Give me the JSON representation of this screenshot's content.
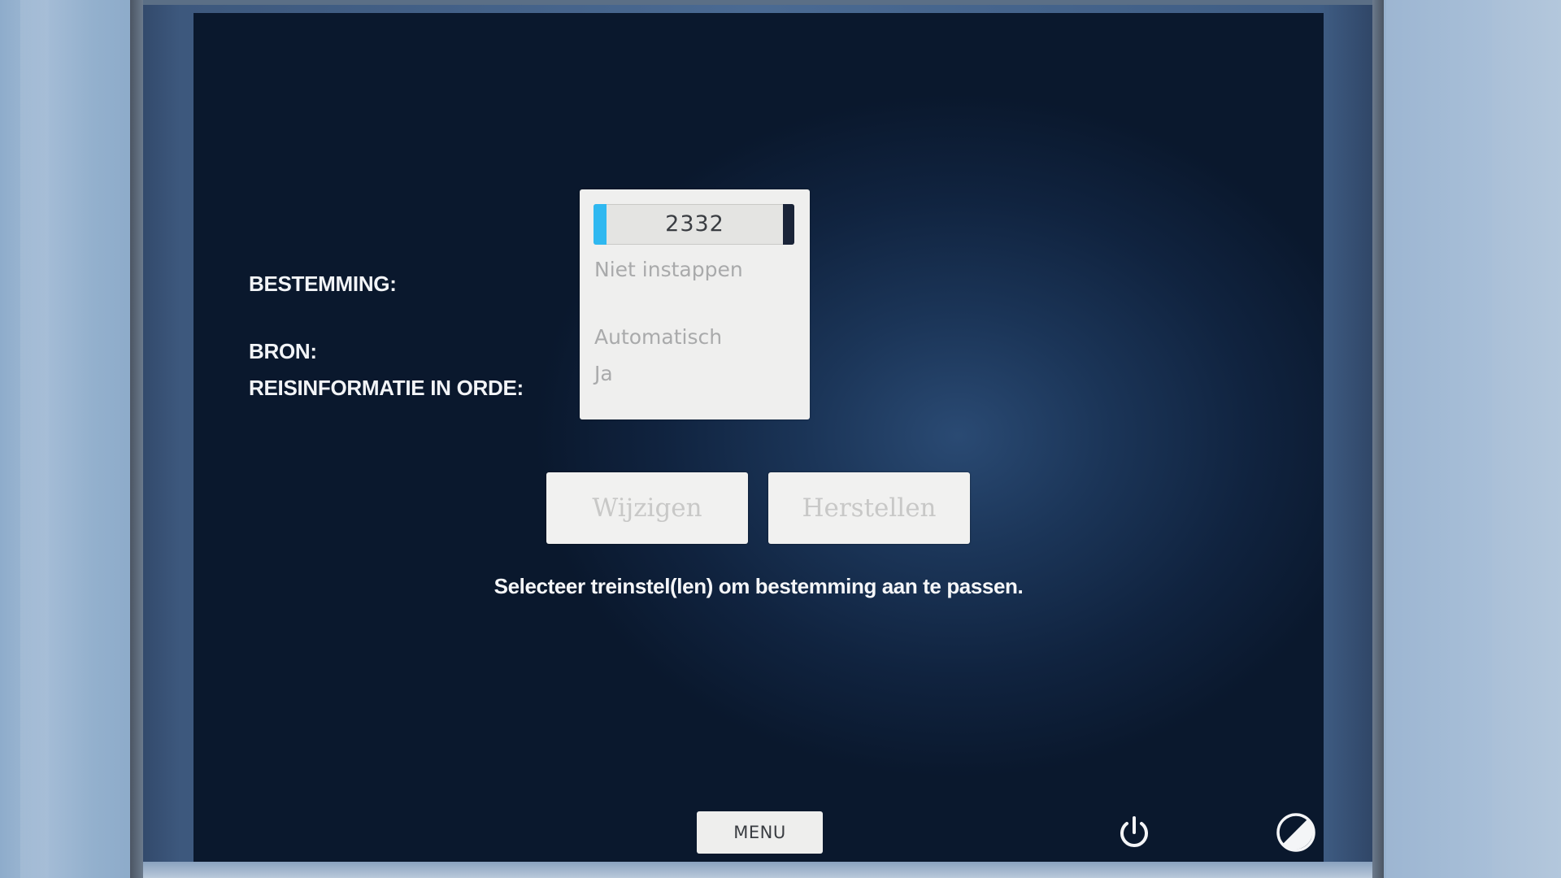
{
  "labels": {
    "destination": "BESTEMMING:",
    "source": "BRON:",
    "travel_info": "REISINFORMATIE IN ORDE:"
  },
  "values": {
    "train_number": "2332",
    "destination": "Niet instappen",
    "source": "Automatisch",
    "travel_info": "Ja"
  },
  "buttons": {
    "change": "Wijzigen",
    "restore": "Herstellen",
    "menu": "MENU"
  },
  "hint": "Selecteer treinstel(len) om bestemming aan te passen.",
  "icons": {
    "power": "power-icon",
    "brightness": "brightness-icon"
  },
  "colors": {
    "accent": "#2fb8f0",
    "screen_bg": "#10233f"
  }
}
